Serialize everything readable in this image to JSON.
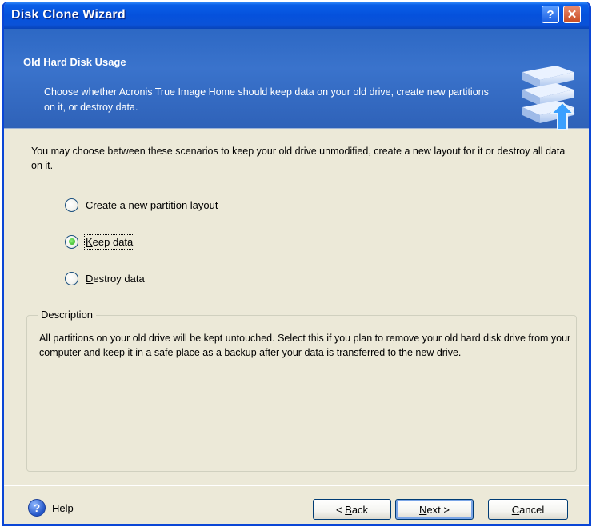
{
  "window": {
    "title": "Disk Clone Wizard",
    "help_glyph": "?",
    "close_glyph": "✕"
  },
  "header": {
    "title": "Old Hard Disk Usage",
    "description": "Choose whether Acronis True Image Home should keep data on your old drive, create new partitions on it, or destroy data.",
    "icon": "hard-disk-stack-icon"
  },
  "intro": "You may choose between these scenarios to keep your old drive unmodified, create a new layout for it or destroy all data on it.",
  "options": [
    {
      "key": "C",
      "rest": "reate a new partition layout",
      "checked": false
    },
    {
      "key": "K",
      "rest": "eep data",
      "checked": true
    },
    {
      "key": "D",
      "rest": "estroy data",
      "checked": false
    }
  ],
  "description_group": {
    "legend": "Description",
    "text": "All partitions on your old drive will be kept untouched. Select this if you plan to remove your old hard disk drive from your computer and keep it in a safe place as a backup after your data is transferred to the new drive."
  },
  "footer": {
    "help_icon_glyph": "?",
    "help_key": "H",
    "help_rest": "elp",
    "back_prefix": "< ",
    "back_key": "B",
    "back_rest": "ack",
    "next_key": "N",
    "next_rest": "ext >",
    "cancel_key": "C",
    "cancel_rest": "ancel"
  }
}
